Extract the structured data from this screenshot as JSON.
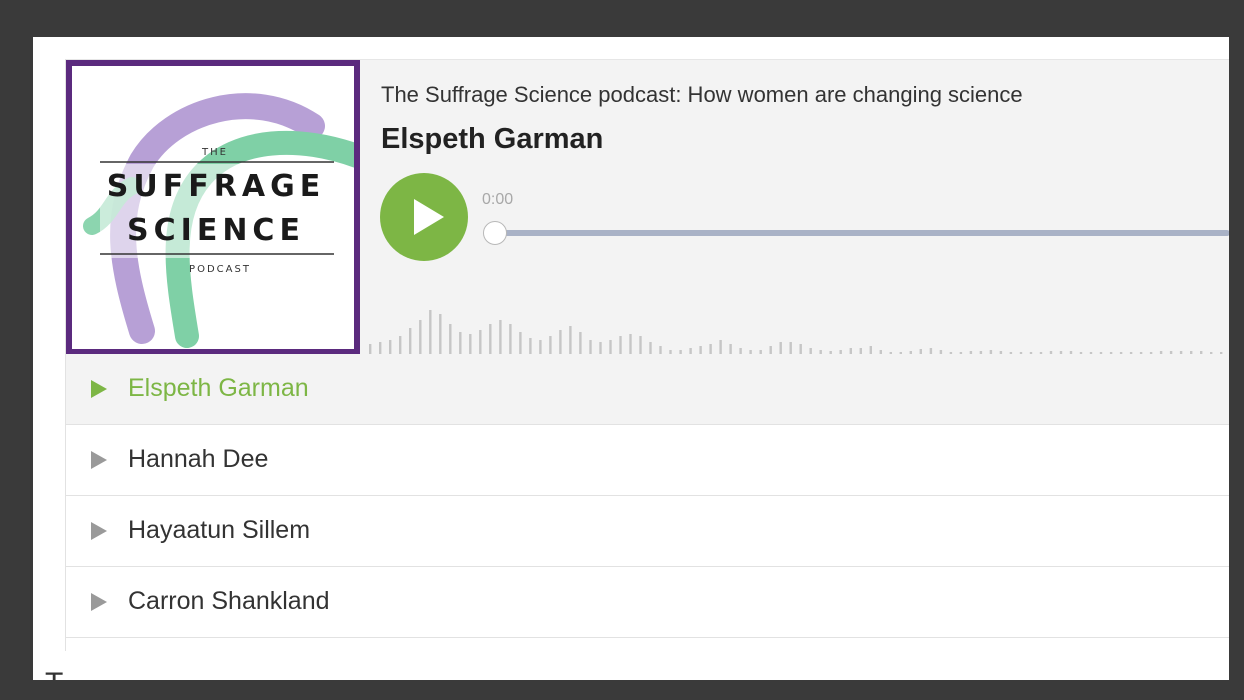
{
  "podcast": {
    "show_title": "The Suffrage Science podcast: How women are changing science",
    "current_episode": "Elspeth Garman",
    "time": "0:00",
    "progress": 0
  },
  "cover_art": {
    "line_the": "THE",
    "line_suffrage": "SUFFRAGE",
    "line_science": "SCIENCE",
    "line_podcast": "PODCAST"
  },
  "episodes": [
    {
      "title": "Elspeth Garman",
      "active": true
    },
    {
      "title": "Hannah Dee",
      "active": false
    },
    {
      "title": "Hayaatun Sillem",
      "active": false
    },
    {
      "title": "Carron Shankland",
      "active": false
    }
  ],
  "page": {
    "bottom_text": "T"
  },
  "colors": {
    "accent": "#7db645",
    "border_purple": "#5b2a7e",
    "track": "#a9b2c6",
    "waveform": "#c6c6c6",
    "inactive_icon": "#9a9a9a"
  },
  "icons": {
    "play": "play-icon",
    "episode": "triangle-right-icon"
  }
}
